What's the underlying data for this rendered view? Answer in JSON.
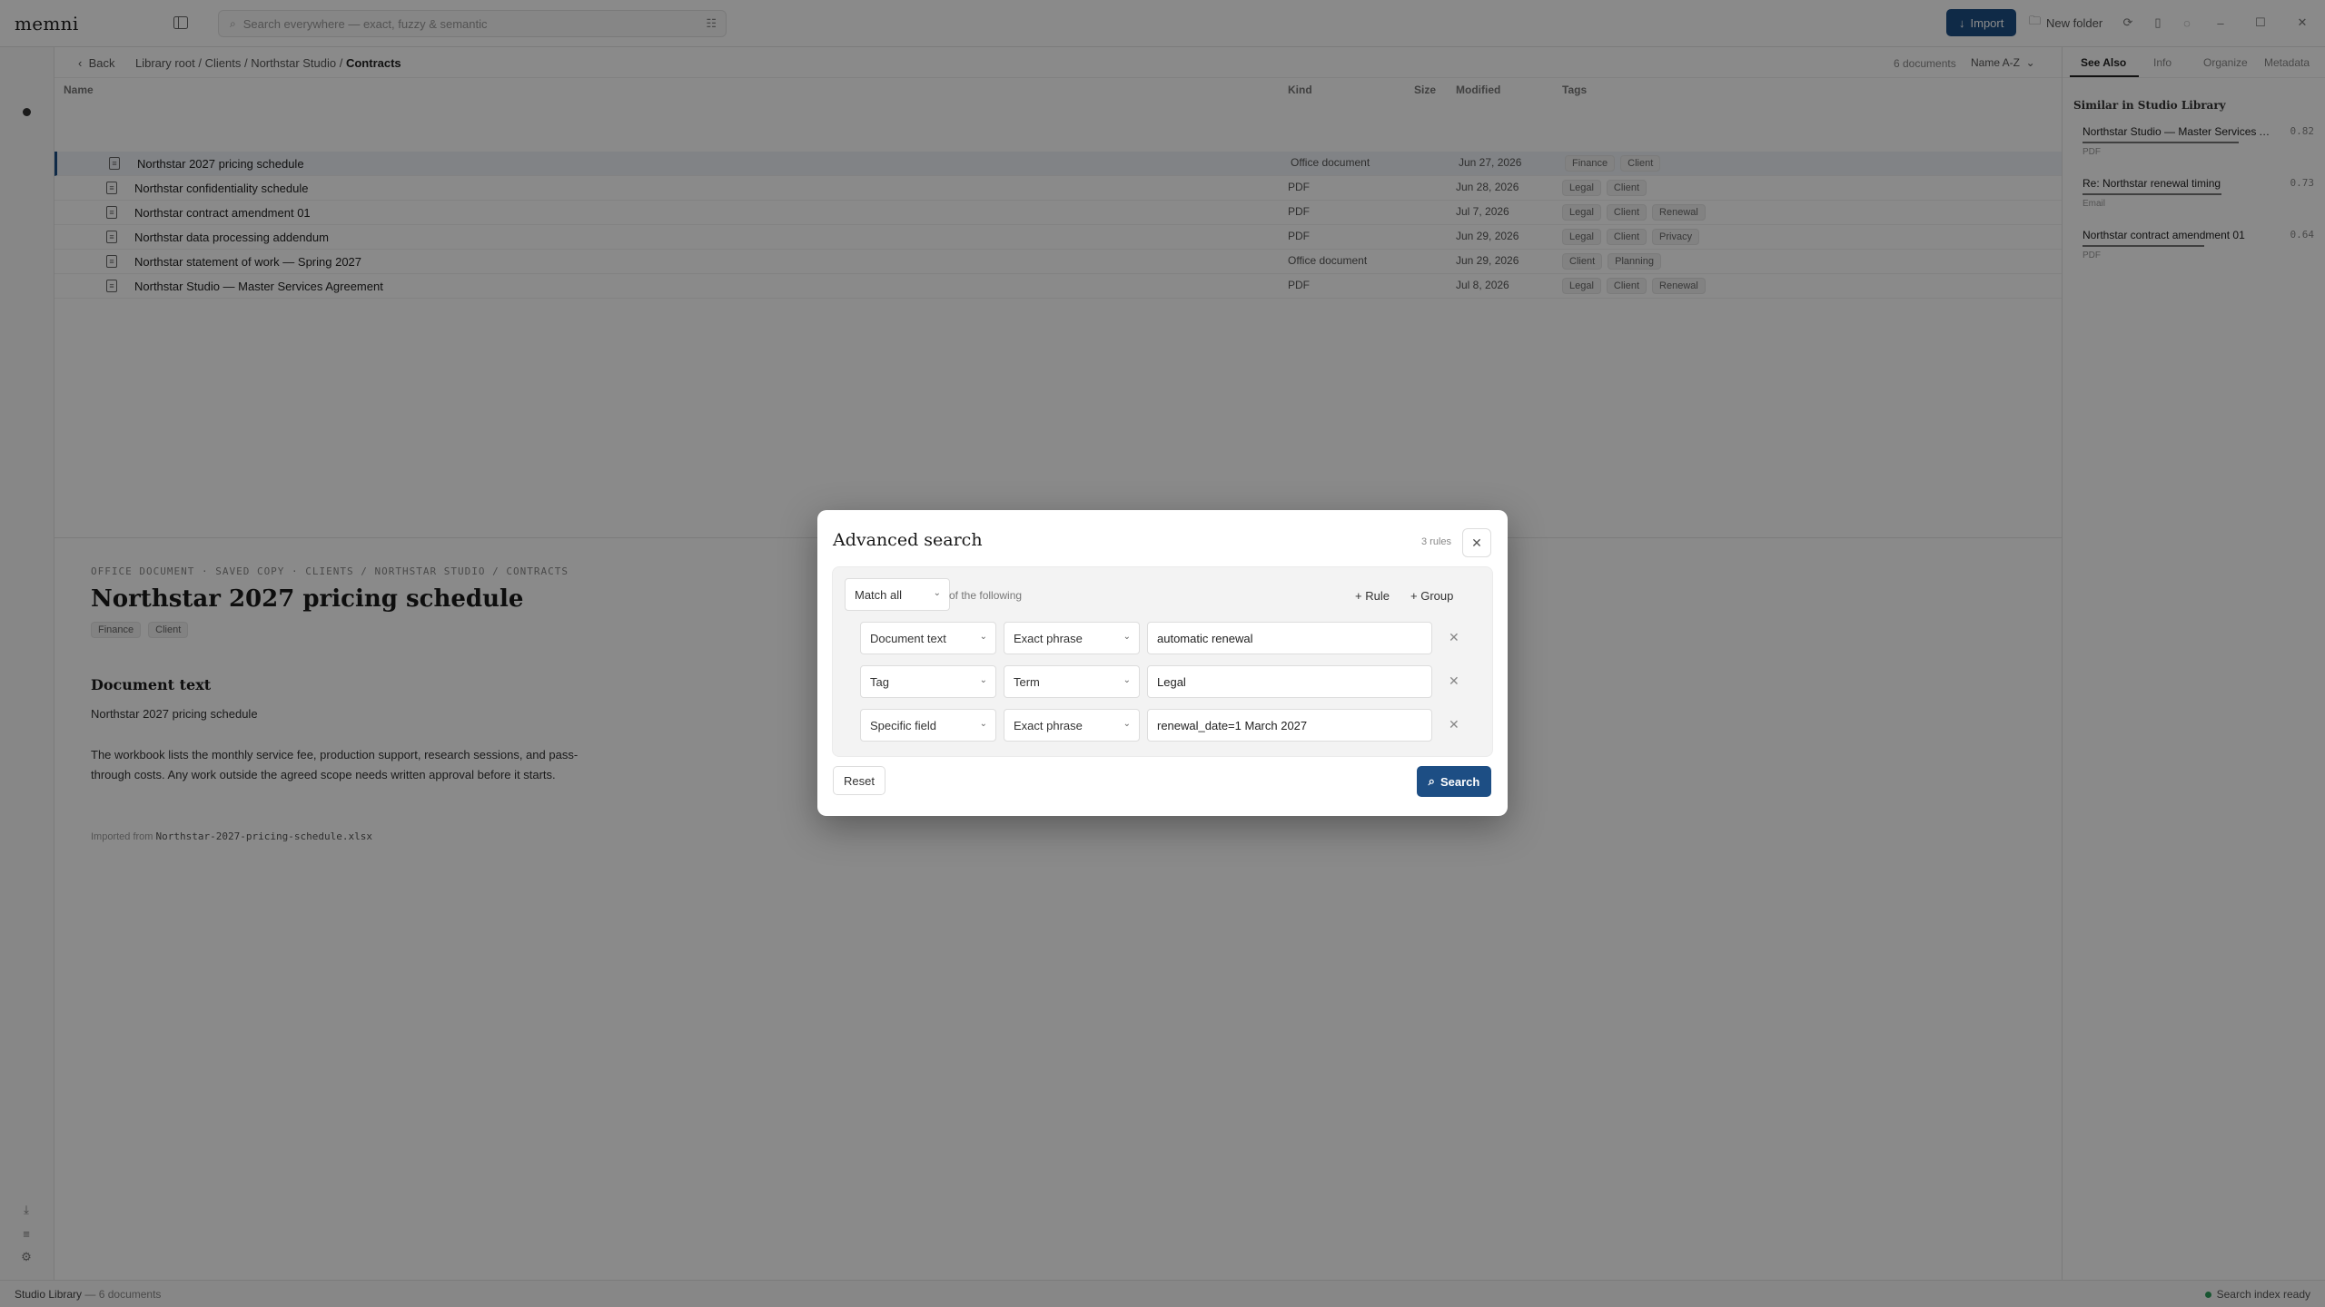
{
  "app": {
    "logo": "memni"
  },
  "topbar": {
    "search_placeholder": "Search everywhere — exact, fuzzy & semantic",
    "import_label": "Import",
    "new_folder_label": "New folder"
  },
  "nav": {
    "back_label": "Back",
    "breadcrumb": [
      "Library root",
      "Clients",
      "Northstar Studio",
      "Contracts"
    ],
    "doc_count": "6 documents",
    "sort_label": "Name A-Z"
  },
  "columns": {
    "name": "Name",
    "kind": "Kind",
    "size": "Size",
    "modified": "Modified",
    "tags": "Tags"
  },
  "files": [
    {
      "name": "Northstar 2027 pricing schedule",
      "kind": "Office document",
      "modified": "Jun 27, 2026",
      "tags": [
        "Finance",
        "Client"
      ]
    },
    {
      "name": "Northstar confidentiality schedule",
      "kind": "PDF",
      "modified": "Jun 28, 2026",
      "tags": [
        "Legal",
        "Client"
      ]
    },
    {
      "name": "Northstar contract amendment 01",
      "kind": "PDF",
      "modified": "Jul 7, 2026",
      "tags": [
        "Legal",
        "Client",
        "Renewal"
      ]
    },
    {
      "name": "Northstar data processing addendum",
      "kind": "PDF",
      "modified": "Jun 29, 2026",
      "tags": [
        "Legal",
        "Client",
        "Privacy"
      ]
    },
    {
      "name": "Northstar statement of work — Spring 2027",
      "kind": "Office document",
      "modified": "Jun 29, 2026",
      "tags": [
        "Client",
        "Planning"
      ]
    },
    {
      "name": "Northstar Studio — Master Services Agreement",
      "kind": "PDF",
      "modified": "Jul 8, 2026",
      "tags": [
        "Legal",
        "Client",
        "Renewal"
      ]
    }
  ],
  "preview": {
    "meta": "OFFICE DOCUMENT · SAVED COPY · CLIENTS / NORTHSTAR STUDIO / CONTRACTS",
    "title": "Northstar 2027 pricing schedule",
    "tags": [
      "Finance",
      "Client"
    ],
    "section_heading": "Document text",
    "para1": "Northstar 2027 pricing schedule",
    "para2": "The workbook lists the monthly service fee, production support, research sessions, and pass-through costs. Any work outside the agreed scope needs written approval before it starts.",
    "imported_from_label": "Imported from",
    "imported_file": "Northstar-2027-pricing-schedule.xlsx"
  },
  "right_panel": {
    "tabs": [
      "See Also",
      "Info",
      "Organize",
      "Metadata"
    ],
    "active_tab": "See Also",
    "heading": "Similar in Studio Library",
    "items": [
      {
        "title": "Northstar Studio — Master Services Agreement",
        "score": "0.82",
        "kind": "PDF",
        "score_value": 0.82
      },
      {
        "title": "Re: Northstar renewal timing",
        "score": "0.73",
        "kind": "Email",
        "score_value": 0.73
      },
      {
        "title": "Northstar contract amendment 01",
        "score": "0.64",
        "kind": "PDF",
        "score_value": 0.64
      }
    ]
  },
  "status": {
    "library": "Studio Library",
    "docs": "— 6 documents",
    "index_status": "Search index ready",
    "index_color": "#2e9d5b"
  },
  "modal": {
    "title": "Advanced search",
    "rule_count": "3 rules",
    "match_value": "Match all",
    "of_following": "of the following",
    "add_rule_label": "+ Rule",
    "add_group_label": "+ Group",
    "rules": [
      {
        "field": "Document text",
        "operator": "Exact phrase",
        "value": "automatic renewal"
      },
      {
        "field": "Tag",
        "operator": "Term",
        "value": "Legal"
      },
      {
        "field": "Specific field",
        "operator": "Exact phrase",
        "value": "renewal_date=1 March 2027"
      }
    ],
    "reset_label": "Reset",
    "search_label": "Search",
    "accent": "#1d4e84"
  }
}
